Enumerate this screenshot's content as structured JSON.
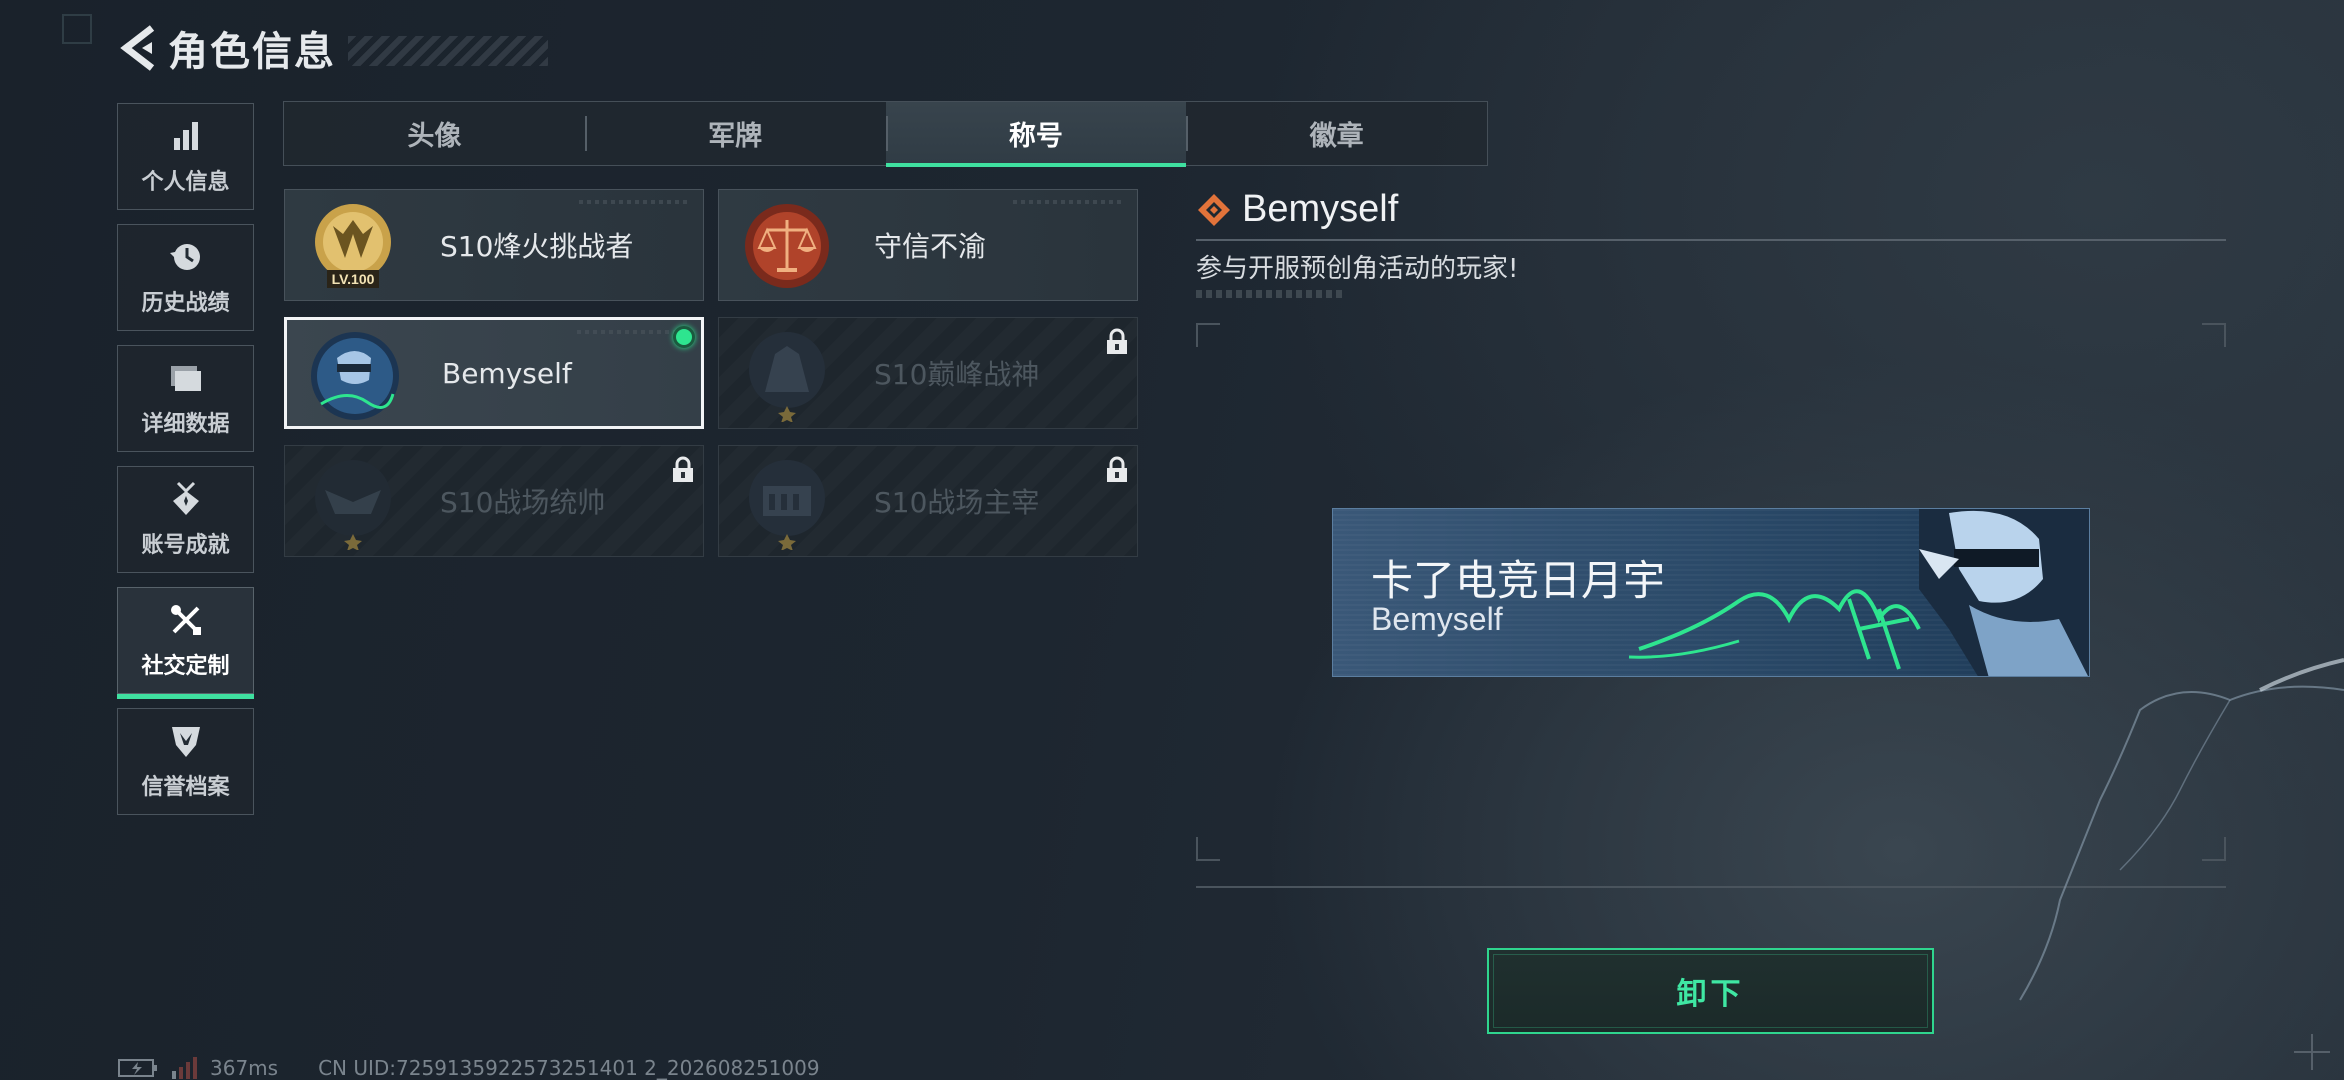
{
  "header": {
    "title": "角色信息"
  },
  "sidebar": {
    "items": [
      {
        "label": "个人信息",
        "icon": "bar-chart-icon"
      },
      {
        "label": "历史战绩",
        "icon": "history-icon"
      },
      {
        "label": "详细数据",
        "icon": "folder-icon"
      },
      {
        "label": "账号成就",
        "icon": "medal-icon"
      },
      {
        "label": "社交定制",
        "icon": "tools-icon",
        "active": true
      },
      {
        "label": "信誉档案",
        "icon": "shield-icon"
      }
    ]
  },
  "tabs": [
    {
      "label": "头像"
    },
    {
      "label": "军牌"
    },
    {
      "label": "称号",
      "active": true
    },
    {
      "label": "徽章"
    }
  ],
  "titles": [
    {
      "name": "S10烽火挑战者",
      "state": "owned",
      "badge_text": "LV.100"
    },
    {
      "name": "守信不渝",
      "state": "owned"
    },
    {
      "name": "Bemyself",
      "state": "equipped"
    },
    {
      "name": "S10巅峰战神",
      "state": "locked"
    },
    {
      "name": "S10战场统帅",
      "state": "locked"
    },
    {
      "name": "S10战场主宰",
      "state": "locked"
    }
  ],
  "detail": {
    "name": "Bemyself",
    "description": "参与开服预创角活动的玩家!",
    "banner_title": "卡了电竞日月宇",
    "banner_subtitle": "Bemyself"
  },
  "actions": {
    "unequip_label": "卸下"
  },
  "status_bar": {
    "ping": "367ms",
    "uid": "CN UID:7259135922573251401 2_202608251009"
  },
  "colors": {
    "accent": "#3fe0a0",
    "online_dot": "#2ee58f",
    "banner_bg": "#2c4b6a"
  }
}
